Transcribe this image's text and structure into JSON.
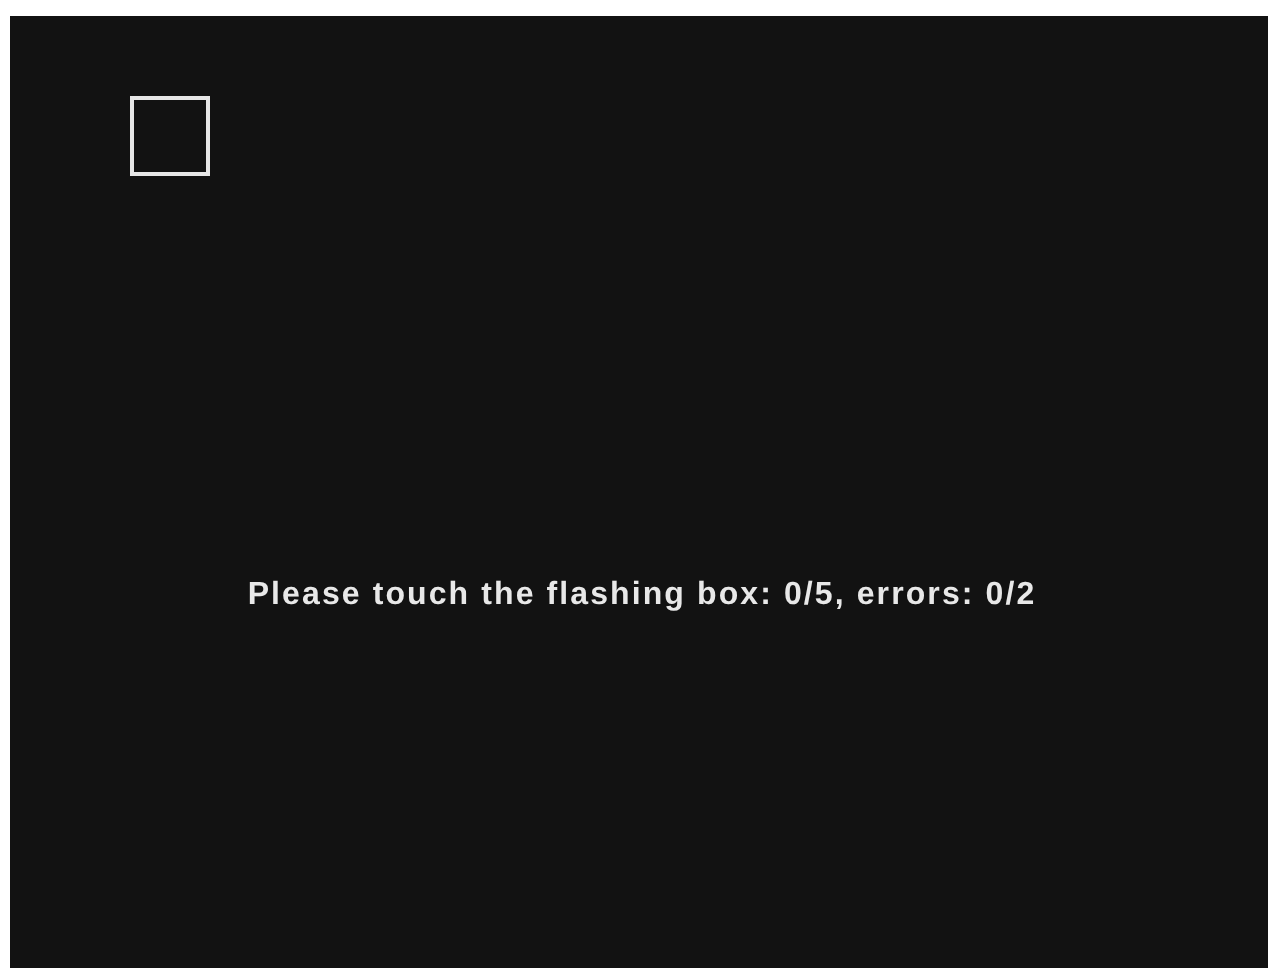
{
  "prompt": "Please touch the flashing box: 0/5, errors: 0/2"
}
